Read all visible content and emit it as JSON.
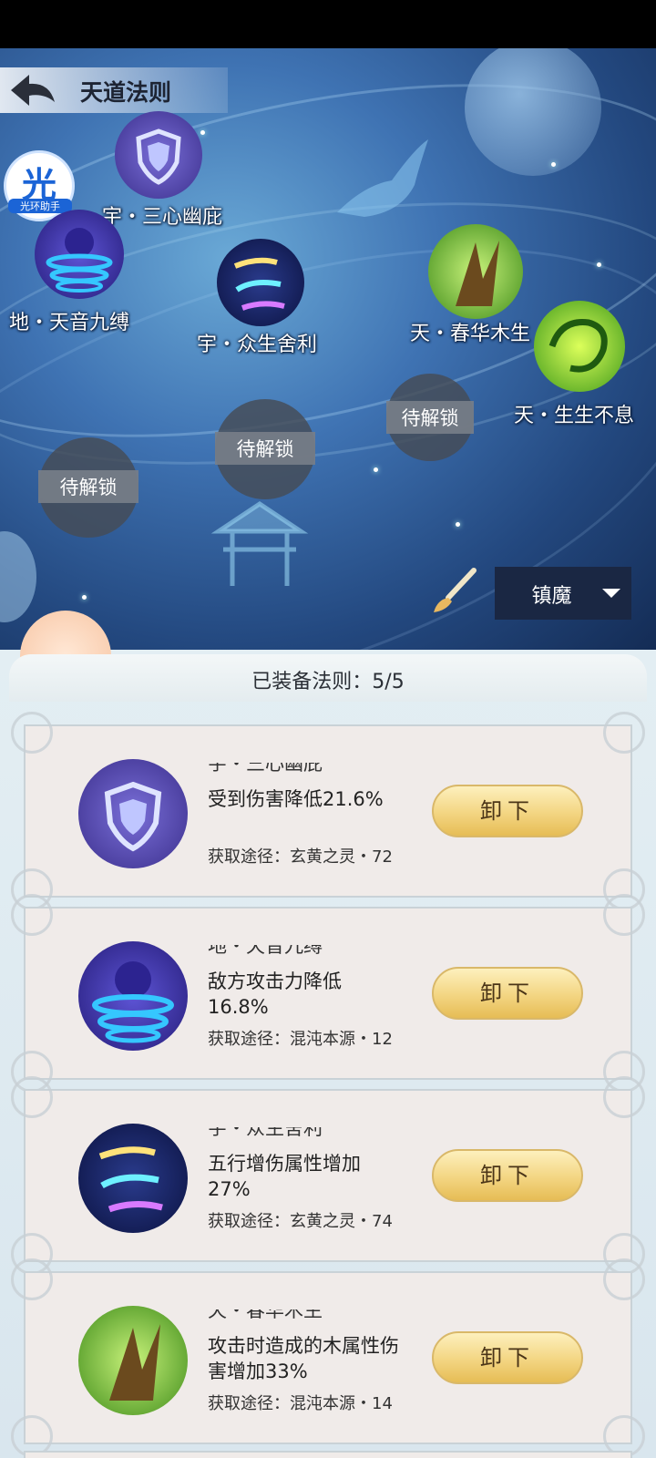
{
  "header": {
    "title": "天道法则",
    "back_icon": "back-arrow-icon"
  },
  "helper": {
    "glyph": "光",
    "label": "光环助手"
  },
  "nodes": [
    {
      "label": "宇・三心幽庇",
      "icon": "shield-icon"
    },
    {
      "label": "地・天音九缚",
      "icon": "spirit-vortex-icon"
    },
    {
      "label": "宇・众生舍利",
      "icon": "comet-orb-icon"
    },
    {
      "label": "天・春华木生",
      "icon": "wood-spike-icon"
    },
    {
      "label": "天・生生不息",
      "icon": "green-vine-icon"
    }
  ],
  "locked": [
    "待解锁",
    "待解锁",
    "待解锁"
  ],
  "filter": {
    "selected": "镇魔",
    "brush_icon": "brush-icon"
  },
  "equipped_label": "已装备法则：5/5",
  "cards": [
    {
      "name": "宇・三心幽庇",
      "desc": "受到伤害降低21.6%",
      "source": "获取途径：玄黄之灵・72",
      "button": "卸下",
      "icon": "shield-icon"
    },
    {
      "name": "地・天音九缚",
      "desc": "敌方攻击力降低16.8%",
      "source": "获取途径：混沌本源・12",
      "button": "卸下",
      "icon": "spirit-vortex-icon"
    },
    {
      "name": "宇・众生舍利",
      "desc": "五行增伤属性增加27%",
      "source": "获取途径：玄黄之灵・74",
      "button": "卸下",
      "icon": "comet-orb-icon"
    },
    {
      "name": "天・春华木生",
      "desc": "攻击时造成的木属性伤害增加33%",
      "source": "获取途径：混沌本源・14",
      "button": "卸下",
      "icon": "wood-spike-icon"
    }
  ]
}
